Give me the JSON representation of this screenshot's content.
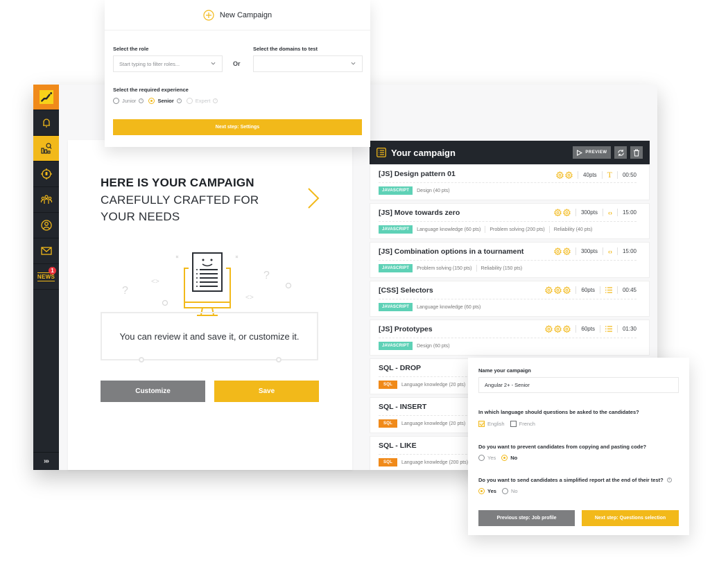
{
  "colors": {
    "accent": "#f2b91a",
    "brand_orange": "#f08a1a",
    "sidebar_bg": "#22262c",
    "js_tag": "#5ed1b6",
    "sql_tag": "#f08a1a",
    "grey_button": "#7d7e80",
    "badge_red": "#e8333b"
  },
  "sidebar": {
    "items": [
      {
        "icon": "logo-icon",
        "active": false
      },
      {
        "icon": "bell-icon",
        "active": false
      },
      {
        "icon": "analytics-icon",
        "active": true
      },
      {
        "icon": "target-icon",
        "active": false
      },
      {
        "icon": "team-icon",
        "active": false
      },
      {
        "icon": "user-icon",
        "active": false
      },
      {
        "icon": "mail-icon",
        "active": false
      },
      {
        "icon": "news-icon",
        "label": "NEWS",
        "badge": "1"
      }
    ],
    "expand_label": "»›"
  },
  "hero": {
    "title": "HERE IS YOUR CAMPAIGN",
    "subtitle": "CAREFULLY CRAFTED FOR YOUR NEEDS",
    "message": "You can review it and save it, or customize it.",
    "customize_label": "Customize",
    "save_label": "Save"
  },
  "campaign": {
    "title": "Your campaign",
    "preview_label": "PREVIEW",
    "questions": [
      {
        "title": "[JS] Design pattern 01",
        "difficulty": 2,
        "points": "40pts",
        "type_icon": "text-icon",
        "time": "00:50",
        "tag": "JAVASCRIPT",
        "tag_type": "js",
        "skills": [
          "Design (40 pts)"
        ]
      },
      {
        "title": "[JS] Move towards zero",
        "difficulty": 2,
        "points": "300pts",
        "type_icon": "code-icon",
        "time": "15:00",
        "tag": "JAVASCRIPT",
        "tag_type": "js",
        "skills": [
          "Language knowledge (60 pts)",
          "Problem solving (200 pts)",
          "Reliability (40 pts)"
        ]
      },
      {
        "title": "[JS] Combination options in a tournament",
        "difficulty": 2,
        "points": "300pts",
        "type_icon": "code-icon",
        "time": "15:00",
        "tag": "JAVASCRIPT",
        "tag_type": "js",
        "skills": [
          "Problem solving (150 pts)",
          "Reliability (150 pts)"
        ]
      },
      {
        "title": "[CSS] Selectors",
        "difficulty": 3,
        "points": "60pts",
        "type_icon": "list-icon",
        "time": "00:45",
        "tag": "JAVASCRIPT",
        "tag_type": "js",
        "skills": [
          "Language knowledge (60 pts)"
        ]
      },
      {
        "title": "[JS] Prototypes",
        "difficulty": 3,
        "points": "60pts",
        "type_icon": "list-icon",
        "time": "01:30",
        "tag": "JAVASCRIPT",
        "tag_type": "js",
        "skills": [
          "Design (60 pts)"
        ]
      },
      {
        "title": "SQL - DROP",
        "tag": "SQL",
        "tag_type": "sql",
        "skills": [
          "Language knowledge (20 pts)"
        ]
      },
      {
        "title": "SQL - INSERT",
        "tag": "SQL",
        "tag_type": "sql",
        "skills": [
          "Language knowledge (20 pts)"
        ]
      },
      {
        "title": "SQL - LIKE",
        "tag": "SQL",
        "tag_type": "sql",
        "skills": [
          "Language knowledge (200 pts)"
        ]
      }
    ]
  },
  "new_campaign": {
    "title": "New Campaign",
    "role_label": "Select the role",
    "role_placeholder": "Start typing to filter roles...",
    "or_label": "Or",
    "domains_label": "Select the domains to test",
    "domains_value": "",
    "experience_label": "Select the required experience",
    "experience_options": [
      {
        "label": "Junior",
        "state": "unchecked"
      },
      {
        "label": "Senior",
        "state": "checked"
      },
      {
        "label": "Expert",
        "state": "disabled"
      }
    ],
    "next_label": "Next step: Settings"
  },
  "settings": {
    "name_label": "Name your campaign",
    "name_value": "Angular 2+ - Senior",
    "language_question": "In which language should questions be asked to the candidates?",
    "language_options": [
      {
        "label": "English",
        "checked": true
      },
      {
        "label": "French",
        "checked": false
      }
    ],
    "copy_question": "Do you want to prevent candidates from copying and pasting code?",
    "copy_options": [
      {
        "label": "Yes",
        "checked": false
      },
      {
        "label": "No",
        "checked": true
      }
    ],
    "report_question": "Do you want to send candidates a simplified report at the end of their test?",
    "report_options": [
      {
        "label": "Yes",
        "checked": true
      },
      {
        "label": "No",
        "checked": false
      }
    ],
    "prev_label": "Previous step: Job profile",
    "next_label": "Next step: Questions selection"
  }
}
